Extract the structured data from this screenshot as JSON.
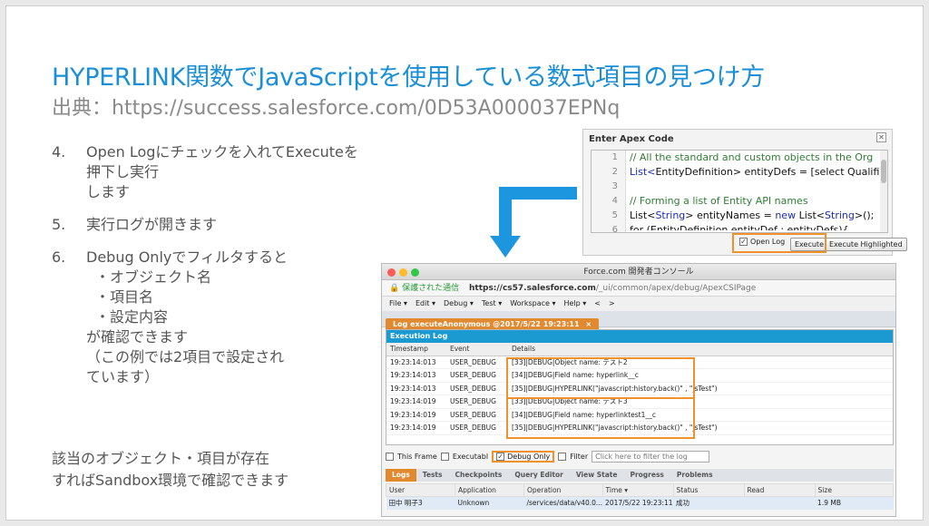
{
  "title": "HYPERLINK関数でJavaScriptを使用している数式項目の見つけ方",
  "subtitle": "出典：https://success.salesforce.com/0D53A000037EPNq",
  "steps": [
    {
      "num": "4.",
      "lines": [
        "Open Logにチェックを入れてExecuteを押下し実行",
        "します"
      ]
    },
    {
      "num": "5.",
      "lines": [
        "実行ログが開きます"
      ]
    },
    {
      "num": "6.",
      "lines": [
        "Debug Onlyでフィルタすると"
      ],
      "subs": [
        "・オブジェクト名",
        "・項目名",
        "・設定内容"
      ],
      "after": [
        "が確認できます",
        "（この例では2項目で設定され",
        "ています）"
      ]
    }
  ],
  "note": [
    "該当のオブジェクト・項目が存在",
    "すればSandbox環境で確認できます"
  ],
  "apex": {
    "header": "Enter Apex Code",
    "close": "✕",
    "line_numbers": [
      "1",
      "2",
      "3",
      "4",
      "5",
      "6"
    ],
    "code": [
      {
        "type": "comment",
        "text": "// All the standard and custom objects in the Org"
      },
      {
        "type": "mixed",
        "parts": [
          {
            "kw": false,
            "t": "List<"
          },
          {
            "kw": false,
            "t": "EntityDefinition> entityDefs = [select Qualifie"
          }
        ]
      },
      {
        "type": "blank",
        "text": ""
      },
      {
        "type": "comment",
        "text": "// Forming a list of Entity API names"
      },
      {
        "type": "list",
        "text_a": "List<",
        "kw": "String",
        "text_b": "> entityNames = ",
        "kw2": "new",
        "text_c": " List<",
        "kw3": "String",
        "text_d": ">();"
      },
      {
        "type": "plain",
        "text": "for (EntityDefinition entityDef : entityDefs){"
      }
    ],
    "open_log_label": "Open Log",
    "open_log_checked": true,
    "execute_label": "Execute",
    "execute_highlighted_label": "Execute Highlighted"
  },
  "console": {
    "window_title": "Force.com 開発者コンソール",
    "secure_label": "保護された通信",
    "url_bold": "https://cs57.salesforce.com",
    "url_rest": "/_ui/common/apex/debug/ApexCSIPage",
    "menus": [
      "File ▾",
      "Edit ▾",
      "Debug ▾",
      "Test ▾",
      "Workspace ▾",
      "Help ▾",
      "<",
      ">"
    ],
    "log_tab": "Log executeAnonymous @2017/5/22 19:23:11",
    "log_tab_close": "×",
    "exec_log_header": "Execution Log",
    "columns": [
      "Timestamp",
      "Event",
      "Details"
    ],
    "rows": [
      [
        "19:23:14:013",
        "USER_DEBUG",
        "[33]|DEBUG|Object name: テスト2"
      ],
      [
        "19:23:14:013",
        "USER_DEBUG",
        "[34]|DEBUG|Field name: hyperlink__c"
      ],
      [
        "19:23:14:013",
        "USER_DEBUG",
        "[35]|DEBUG|HYPERLINK(\"javascript:history.back()\" , \"jsTest\")"
      ],
      [
        "19:23:14:019",
        "USER_DEBUG",
        "[33]|DEBUG|Object name: テスト3"
      ],
      [
        "19:23:14:019",
        "USER_DEBUG",
        "[34]|DEBUG|Field name: hyperlinktest1__c"
      ],
      [
        "19:23:14:019",
        "USER_DEBUG",
        "[35]|DEBUG|HYPERLINK(\"javascript:history.back()\" , \"jsTest\")"
      ]
    ],
    "filters": {
      "this_frame": "This Frame",
      "executable": "Executabl",
      "debug_only": "Debug Only",
      "debug_only_checked": true,
      "filter": "Filter",
      "filter_placeholder": "Click here to filter the log"
    },
    "bottom_tabs": [
      "Logs",
      "Tests",
      "Checkpoints",
      "Query Editor",
      "View State",
      "Progress",
      "Problems"
    ],
    "bottom_columns": [
      "User",
      "Application",
      "Operation",
      "Time ▾",
      "Status",
      "Read",
      "Size"
    ],
    "bottom_rows": [
      [
        "田中 明子3",
        "Unknown",
        "/services/data/v40.0...",
        "2017/5/22 19:23:11",
        "成功",
        "",
        "1.9 MB"
      ]
    ]
  },
  "colors": {
    "accent": "#1a8fd8",
    "highlight": "#f0922b",
    "tab": "#e2882f"
  }
}
